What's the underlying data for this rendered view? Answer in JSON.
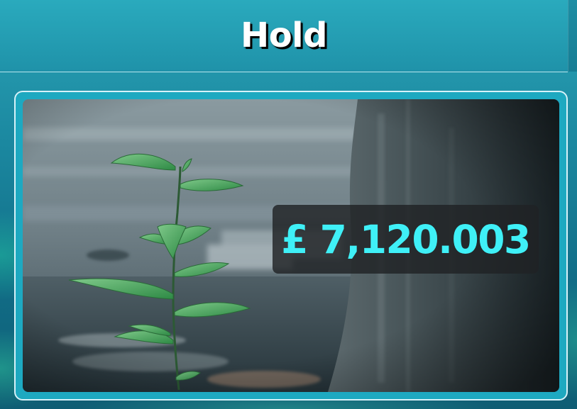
{
  "header": {
    "title": "Hold"
  },
  "card": {
    "image_description_icon": "seedling-photo",
    "price": "£ 7,120.003"
  },
  "colors": {
    "header_bg": "#23a0b4",
    "price_text": "#3ff0f7",
    "price_box_bg": "#202224",
    "card_border": "#ebfaff"
  }
}
